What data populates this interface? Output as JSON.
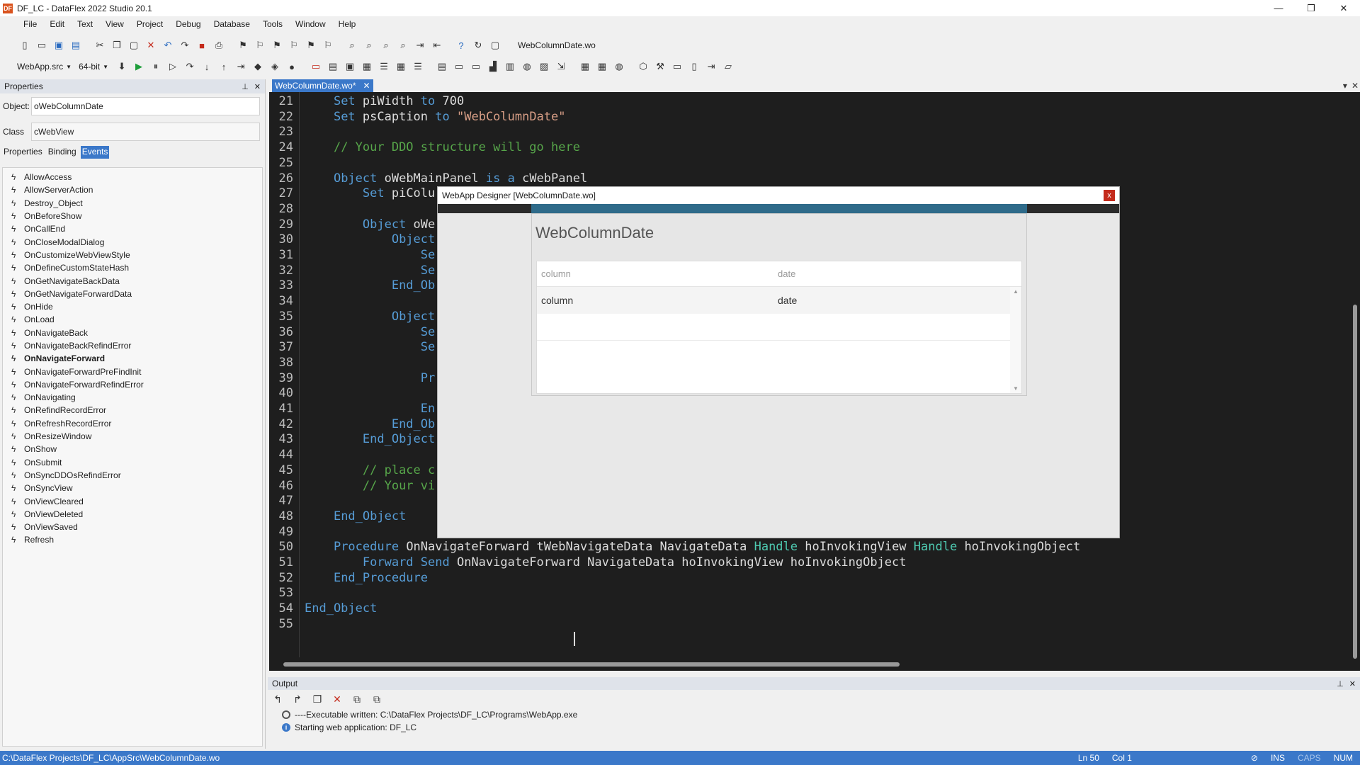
{
  "window": {
    "title": "DF_LC - DataFlex 2022 Studio 20.1",
    "app_icon": "DF",
    "minimize": "—",
    "maximize": "❐",
    "close": "✕"
  },
  "menu": [
    "File",
    "Edit",
    "Text",
    "View",
    "Project",
    "Debug",
    "Database",
    "Tools",
    "Window",
    "Help"
  ],
  "toolbar": {
    "current_file": "WebColumnDate.wo",
    "project_combo": "WebApp.src",
    "bitness_combo": "64-bit"
  },
  "properties_panel": {
    "title": "Properties",
    "object_label": "Object:",
    "object_value": "oWebColumnDate",
    "class_label": "Class",
    "class_value": "cWebView",
    "tabs": [
      "Properties",
      "Binding",
      "Events"
    ],
    "active_tab": "Events",
    "events": [
      "AllowAccess",
      "AllowServerAction",
      "Destroy_Object",
      "OnBeforeShow",
      "OnCallEnd",
      "OnCloseModalDialog",
      "OnCustomizeWebViewStyle",
      "OnDefineCustomStateHash",
      "OnGetNavigateBackData",
      "OnGetNavigateForwardData",
      "OnHide",
      "OnLoad",
      "OnNavigateBack",
      "OnNavigateBackRefindError",
      "OnNavigateForward",
      "OnNavigateForwardPreFindInit",
      "OnNavigateForwardRefindError",
      "OnNavigating",
      "OnRefindRecordError",
      "OnRefreshRecordError",
      "OnResizeWindow",
      "OnShow",
      "OnSubmit",
      "OnSyncDDOsRefindError",
      "OnSyncView",
      "OnViewCleared",
      "OnViewDeleted",
      "OnViewSaved",
      "Refresh"
    ],
    "bold_event": "OnNavigateForward"
  },
  "editor": {
    "tab_label": "WebColumnDate.wo*",
    "tab_close": "✕",
    "lines": [
      {
        "n": "21",
        "parts": [
          [
            "",
            "    "
          ],
          [
            "kw",
            "Set"
          ],
          [
            "",
            " piWidth "
          ],
          [
            "kw",
            "to"
          ],
          [
            "",
            " 700"
          ]
        ]
      },
      {
        "n": "22",
        "parts": [
          [
            "",
            "    "
          ],
          [
            "kw",
            "Set"
          ],
          [
            "",
            " psCaption "
          ],
          [
            "kw",
            "to"
          ],
          [
            "",
            " "
          ],
          [
            "str",
            "\"WebColumnDate\""
          ]
        ]
      },
      {
        "n": "23",
        "parts": []
      },
      {
        "n": "24",
        "parts": [
          [
            "",
            "    "
          ],
          [
            "cmt",
            "// Your DDO structure will go here"
          ]
        ]
      },
      {
        "n": "25",
        "parts": []
      },
      {
        "n": "26",
        "parts": [
          [
            "",
            "    "
          ],
          [
            "kw",
            "Object"
          ],
          [
            "",
            " oWebMainPanel "
          ],
          [
            "kw",
            "is a"
          ],
          [
            "",
            " cWebPanel"
          ]
        ]
      },
      {
        "n": "27",
        "parts": [
          [
            "",
            "        "
          ],
          [
            "kw",
            "Set"
          ],
          [
            "",
            " piColu"
          ]
        ]
      },
      {
        "n": "28",
        "parts": []
      },
      {
        "n": "29",
        "parts": [
          [
            "",
            "        "
          ],
          [
            "kw",
            "Object"
          ],
          [
            "",
            " oWe"
          ]
        ]
      },
      {
        "n": "30",
        "parts": [
          [
            "",
            "            "
          ],
          [
            "kw",
            "Object"
          ]
        ]
      },
      {
        "n": "31",
        "parts": [
          [
            "",
            "                "
          ],
          [
            "kw",
            "Se"
          ]
        ]
      },
      {
        "n": "32",
        "parts": [
          [
            "",
            "                "
          ],
          [
            "kw",
            "Se"
          ]
        ]
      },
      {
        "n": "33",
        "parts": [
          [
            "",
            "            "
          ],
          [
            "kw",
            "End_Ob"
          ]
        ]
      },
      {
        "n": "34",
        "parts": []
      },
      {
        "n": "35",
        "parts": [
          [
            "",
            "            "
          ],
          [
            "kw",
            "Object"
          ]
        ]
      },
      {
        "n": "36",
        "parts": [
          [
            "",
            "                "
          ],
          [
            "kw",
            "Se"
          ]
        ]
      },
      {
        "n": "37",
        "parts": [
          [
            "",
            "                "
          ],
          [
            "kw",
            "Se"
          ]
        ]
      },
      {
        "n": "38",
        "parts": []
      },
      {
        "n": "39",
        "parts": [
          [
            "",
            "                "
          ],
          [
            "kw",
            "Pr"
          ]
        ]
      },
      {
        "n": "40",
        "parts": []
      },
      {
        "n": "41",
        "parts": [
          [
            "",
            "                "
          ],
          [
            "kw",
            "En"
          ]
        ]
      },
      {
        "n": "42",
        "parts": [
          [
            "",
            "            "
          ],
          [
            "kw",
            "End_Ob"
          ]
        ]
      },
      {
        "n": "43",
        "parts": [
          [
            "",
            "        "
          ],
          [
            "kw",
            "End_Object"
          ]
        ]
      },
      {
        "n": "44",
        "parts": []
      },
      {
        "n": "45",
        "parts": [
          [
            "",
            "        "
          ],
          [
            "cmt",
            "// place c"
          ]
        ]
      },
      {
        "n": "46",
        "parts": [
          [
            "",
            "        "
          ],
          [
            "cmt",
            "// Your vi"
          ]
        ]
      },
      {
        "n": "47",
        "parts": []
      },
      {
        "n": "48",
        "parts": [
          [
            "",
            "    "
          ],
          [
            "kw",
            "End_Object"
          ]
        ]
      },
      {
        "n": "49",
        "parts": []
      },
      {
        "n": "50",
        "parts": [
          [
            "",
            "    "
          ],
          [
            "kw",
            "Procedure"
          ],
          [
            "",
            " OnNavigateForward tWebNavigateData NavigateData "
          ],
          [
            "hl",
            "Handle"
          ],
          [
            "",
            " hoInvokingView "
          ],
          [
            "hl",
            "Handle"
          ],
          [
            "",
            " hoInvokingObject"
          ]
        ]
      },
      {
        "n": "51",
        "parts": [
          [
            "",
            "        "
          ],
          [
            "kw",
            "Forward Send"
          ],
          [
            "",
            " OnNavigateForward NavigateData hoInvokingView hoInvokingObject"
          ]
        ]
      },
      {
        "n": "52",
        "parts": [
          [
            "",
            "    "
          ],
          [
            "kw",
            "End_Procedure"
          ]
        ]
      },
      {
        "n": "53",
        "parts": []
      },
      {
        "n": "54",
        "parts": [
          [
            "kw",
            "End_Object"
          ]
        ]
      },
      {
        "n": "55",
        "parts": []
      }
    ]
  },
  "designer": {
    "title": "WebApp Designer [WebColumnDate.wo]",
    "close": "x",
    "view_caption": "WebColumnDate",
    "grid": {
      "headers": [
        "column",
        "date"
      ],
      "row": [
        "column",
        "date"
      ]
    }
  },
  "output": {
    "title": "Output",
    "lines": [
      "----Executable written: C:\\DataFlex Projects\\DF_LC\\Programs\\WebApp.exe",
      "Starting web application: DF_LC"
    ]
  },
  "status": {
    "path": "C:\\DataFlex Projects\\DF_LC\\AppSrc\\WebColumnDate.wo",
    "line": "Ln 50",
    "col": "Col 1",
    "ins": "INS",
    "caps": "CAPS",
    "num": "NUM"
  }
}
